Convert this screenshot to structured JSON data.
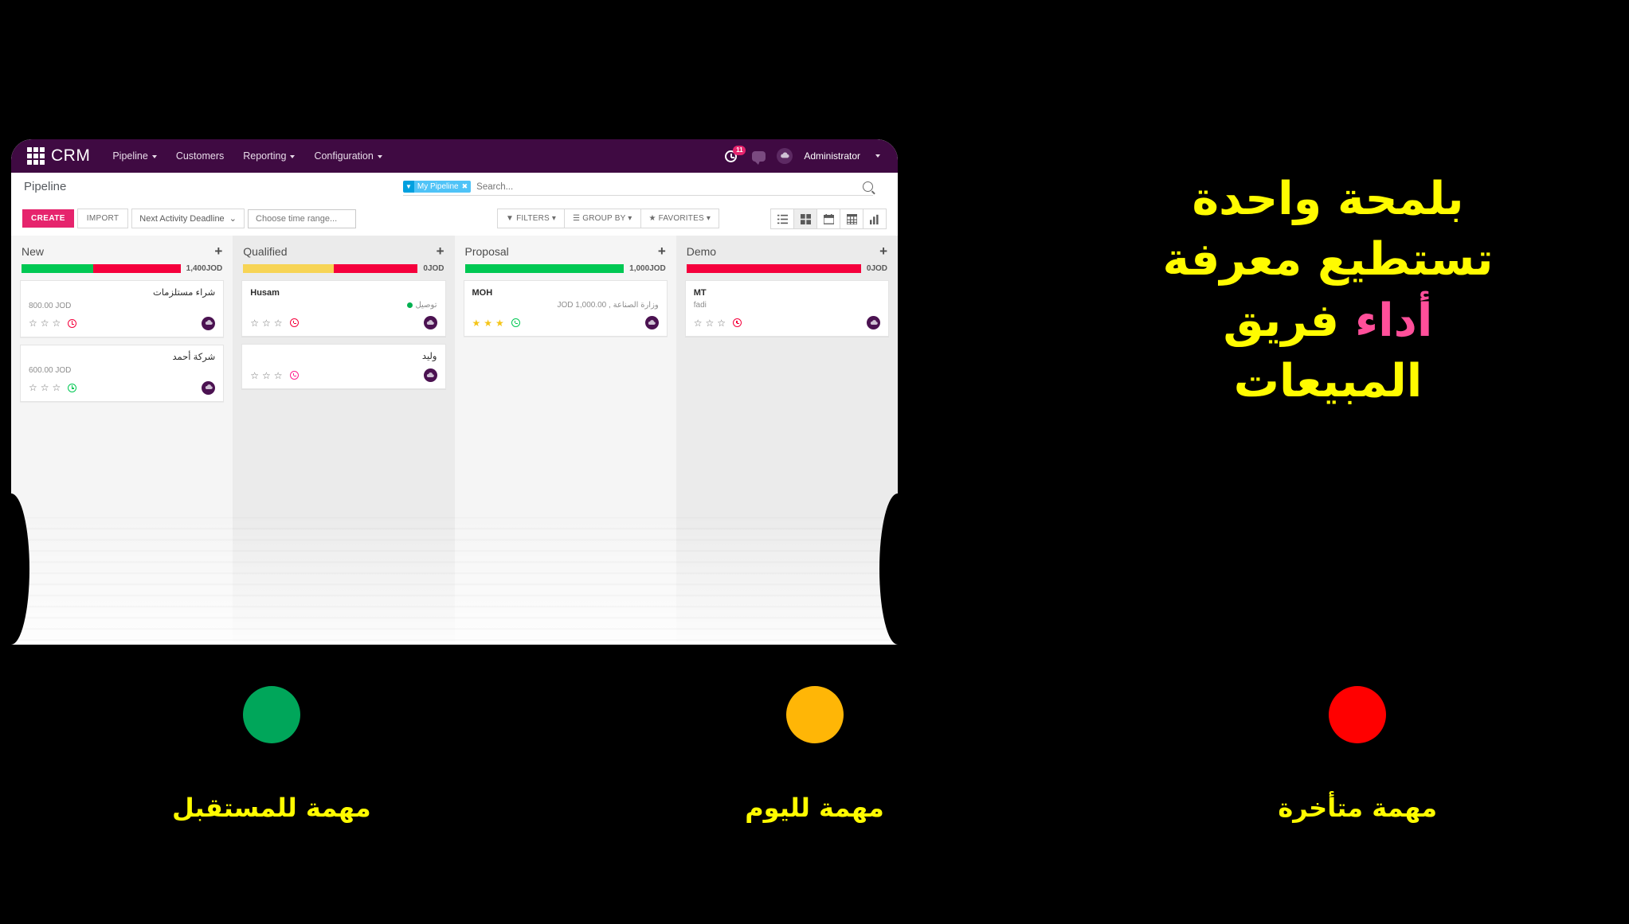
{
  "colors": {
    "nav_purple": "#3f0a42",
    "accent_pink": "#e6246d",
    "yellow": "#fffb00",
    "headline_accent": "#ff4f9a",
    "green": "#00a65a",
    "amber": "#ffb606",
    "red": "#ff0000",
    "bar_green": "#00c853",
    "bar_red": "#f5003c",
    "bar_yellow": "#f7d455"
  },
  "navbar": {
    "apps_icon": "grid-apps-icon",
    "brand": "CRM",
    "items": [
      {
        "label": "Pipeline",
        "has_caret": true
      },
      {
        "label": "Customers",
        "has_caret": false
      },
      {
        "label": "Reporting",
        "has_caret": true
      },
      {
        "label": "Configuration",
        "has_caret": true
      }
    ],
    "activity_icon": "clock-activity-icon",
    "activity_badge": "11",
    "messages_icon": "chat-bubble-icon",
    "avatar_icon": "cloud-avatar-icon",
    "user": "Administrator"
  },
  "control": {
    "page_title": "Pipeline",
    "facet": {
      "icon": "filter-funnel-icon",
      "label": "My Pipeline",
      "close": "✖"
    },
    "search_placeholder": "Search...",
    "search_value": "",
    "search_icon": "search-icon"
  },
  "toolbar": {
    "create_label": "CREATE",
    "import_label": "IMPORT",
    "deadline_select": "Next Activity Deadline",
    "time_range_placeholder": "Choose time range...",
    "time_range_value": "",
    "filters_label": "FILTERS",
    "groupby_label": "GROUP BY",
    "favorites_label": "FAVORITES",
    "views": [
      {
        "name": "list-view-icon",
        "active": false
      },
      {
        "name": "kanban-view-icon",
        "active": true
      },
      {
        "name": "calendar-view-icon",
        "active": false
      },
      {
        "name": "pivot-view-icon",
        "active": false
      },
      {
        "name": "graph-view-icon",
        "active": false
      }
    ]
  },
  "kanban": {
    "columns": [
      {
        "title": "New",
        "add_icon": "plus-icon",
        "amount": "1,400",
        "currency": "JOD",
        "bars": [
          {
            "color": "#00c853",
            "pct": 45
          },
          {
            "color": "#f5003c",
            "pct": 55
          }
        ],
        "shade": "plain",
        "cards": [
          {
            "title": "شراء مستلزمات",
            "rtl_title": true,
            "subtitle": "800.00 JOD",
            "rtl_sub": false,
            "stars_filled": 0,
            "activity_state": "late",
            "avatar": "cloud-avatar-icon",
            "tag_dot": null
          },
          {
            "title": "شركة أحمد",
            "rtl_title": true,
            "subtitle": "600.00 JOD",
            "rtl_sub": false,
            "stars_filled": 0,
            "activity_state": "future",
            "avatar": "cloud-avatar-icon",
            "tag_dot": null
          }
        ]
      },
      {
        "title": "Qualified",
        "add_icon": "plus-icon",
        "amount": "0",
        "currency": "JOD",
        "bars": [
          {
            "color": "#f7d455",
            "pct": 52
          },
          {
            "color": "#f5003c",
            "pct": 48
          }
        ],
        "shade": "alt",
        "cards": [
          {
            "title": "Husam",
            "rtl_title": false,
            "subtitle": "توصيل",
            "rtl_sub": true,
            "stars_filled": 0,
            "activity_state": "late",
            "avatar": "cloud-avatar-icon",
            "tag_dot": "#00b050"
          },
          {
            "title": "وليد",
            "rtl_title": true,
            "subtitle": "",
            "rtl_sub": true,
            "stars_filled": 0,
            "activity_state": "pink",
            "avatar": "cloud-avatar-icon",
            "tag_dot": null
          }
        ]
      },
      {
        "title": "Proposal",
        "add_icon": "plus-icon",
        "amount": "1,000",
        "currency": "JOD",
        "bars": [
          {
            "color": "#00c853",
            "pct": 100
          }
        ],
        "shade": "plain",
        "cards": [
          {
            "title": "MOH",
            "rtl_title": false,
            "subtitle": "وزارة الصناعة , 1,000.00 JOD",
            "rtl_sub": true,
            "stars_filled": 3,
            "activity_state": "future",
            "avatar": "cloud-avatar-icon",
            "tag_dot": null
          }
        ]
      },
      {
        "title": "Demo",
        "add_icon": "plus-icon",
        "amount": "0",
        "currency": "JOD",
        "bars": [
          {
            "color": "#f5003c",
            "pct": 100
          }
        ],
        "shade": "alt",
        "cards": [
          {
            "title": "MT",
            "rtl_title": false,
            "subtitle": "fadi",
            "rtl_sub": false,
            "stars_filled": 0,
            "activity_state": "late",
            "avatar": "cloud-avatar-icon",
            "tag_dot": null
          }
        ]
      }
    ]
  },
  "headline": {
    "line1": "بلمحة واحدة",
    "line2": "تستطيع معرفة",
    "line3_accent": "أداء",
    "line3_rest": "فريق",
    "line4": "المبيعات"
  },
  "legend": [
    {
      "color": "#00a65a",
      "label": "مهمة للمستقبل",
      "name": "legend-future"
    },
    {
      "color": "#ffb606",
      "label": "مهمة لليوم",
      "name": "legend-today"
    },
    {
      "color": "#ff0000",
      "label": "مهمة متأخرة",
      "name": "legend-late"
    }
  ]
}
